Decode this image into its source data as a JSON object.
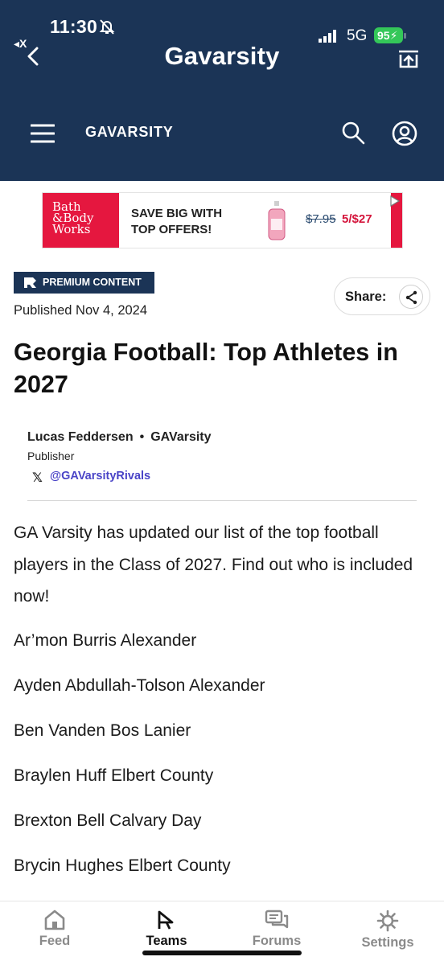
{
  "status_bar": {
    "time": "11:30",
    "back_app": "◂X",
    "network": "5G",
    "battery": "95"
  },
  "app_bar": {
    "title": "Gavarsity"
  },
  "site_header": {
    "brand": "GAVARSITY"
  },
  "ad": {
    "logo_lines": [
      "Bath",
      "&Body",
      "Works"
    ],
    "headline_line1": "SAVE BIG WITH",
    "headline_line2": "TOP OFFERS!",
    "old_price": "$7.95",
    "new_price": "5/$27"
  },
  "article": {
    "badge": "PREMIUM CONTENT",
    "published": "Published Nov 4, 2024",
    "share_label": "Share:",
    "title": "Georgia Football: Top Athletes in 2027",
    "author": {
      "name": "Lucas Feddersen",
      "outlet": "GAVarsity",
      "role": "Publisher",
      "handle": "@GAVarsityRivals"
    },
    "intro": "GA Varsity has updated our list of the top football players in the Class of 2027. Find out who is included now!",
    "players": [
      "Ar’mon Burris Alexander",
      "Ayden Abdullah-Tolson Alexander",
      "Ben Vanden Bos Lanier",
      "Braylen Huff Elbert County",
      "Brexton Bell Calvary Day",
      "Brycin Hughes Elbert County"
    ]
  },
  "tabs": [
    {
      "label": "Feed",
      "icon": "home-icon",
      "active": false
    },
    {
      "label": "Teams",
      "icon": "flag-icon",
      "active": true
    },
    {
      "label": "Forums",
      "icon": "chat-icon",
      "active": false
    },
    {
      "label": "Settings",
      "icon": "gear-icon",
      "active": false
    }
  ],
  "colors": {
    "header_bg": "#1b3456",
    "accent_link": "#4a44c7",
    "battery": "#34c759",
    "ad_red": "#e5173f"
  }
}
